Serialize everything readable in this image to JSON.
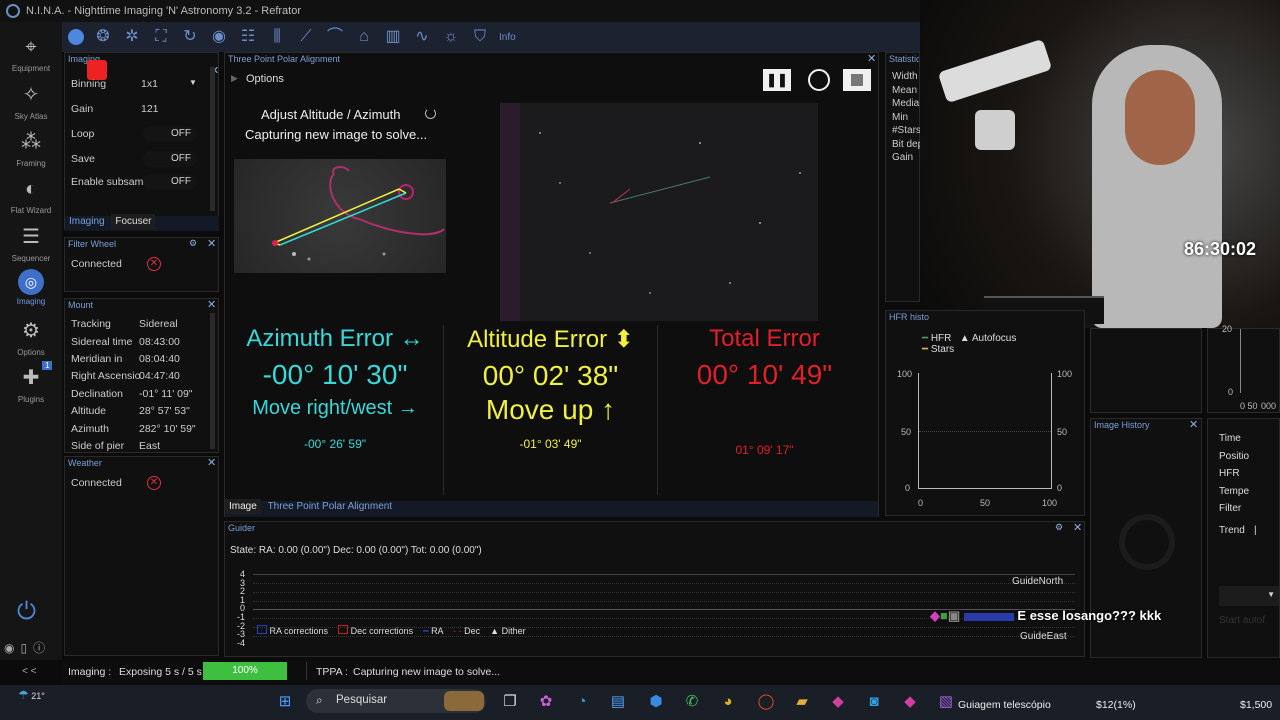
{
  "app": {
    "title": "N.I.N.A. - Nighttime Imaging 'N' Astronomy 3.2  -  Refrator"
  },
  "sidebar": {
    "items": [
      {
        "label": "Equipment"
      },
      {
        "label": "Sky Atlas"
      },
      {
        "label": "Framing"
      },
      {
        "label": "Flat Wizard"
      },
      {
        "label": "Sequencer"
      },
      {
        "label": "Imaging"
      },
      {
        "label": "Options"
      },
      {
        "label": "Plugins",
        "badge": "1"
      }
    ],
    "collapse": "< <"
  },
  "toolbar": {
    "info": "Info"
  },
  "imaging_panel": {
    "title": "Imaging",
    "rows": [
      {
        "label": "Binning",
        "value": "1x1"
      },
      {
        "label": "Gain",
        "value": "121"
      },
      {
        "label": "Loop",
        "value": "OFF"
      },
      {
        "label": "Save",
        "value": "OFF"
      },
      {
        "label": "Enable subsam",
        "value": "OFF"
      }
    ],
    "tabs": [
      "Imaging",
      "Focuser"
    ]
  },
  "filter_wheel": {
    "title": "Filter Wheel",
    "status": "Connected"
  },
  "mount": {
    "title": "Mount",
    "rows": [
      {
        "label": "Tracking",
        "value": "Sidereal"
      },
      {
        "label": "Sidereal time",
        "value": "08:43:00"
      },
      {
        "label": "Meridian in",
        "value": "08:04:40"
      },
      {
        "label": "Right Ascension",
        "value": "04:47:40"
      },
      {
        "label": "Declination",
        "value": "-01° 11' 09\""
      },
      {
        "label": "Altitude",
        "value": "28° 57' 53\""
      },
      {
        "label": "Azimuth",
        "value": "282° 10' 59\""
      },
      {
        "label": "Side of pier",
        "value": "East"
      }
    ]
  },
  "weather": {
    "title": "Weather",
    "status": "Connected"
  },
  "tppa": {
    "title": "Three Point Polar Alignment",
    "options": "Options",
    "step": "Adjust Altitude / Azimuth",
    "status": "Capturing new image to solve...",
    "azimuth": {
      "label": "Azimuth Error ↔",
      "value": "-00° 10' 30\"",
      "move": "Move right/west →",
      "detail": "-00° 26' 59\""
    },
    "altitude": {
      "label": "Altitude Error ⬍",
      "value": "00° 02' 38\"",
      "move": "Move up ↑",
      "detail": "-01° 03' 49\""
    },
    "total": {
      "label": "Total Error",
      "value": "00° 10' 49\"",
      "detail": "01° 09' 17\""
    },
    "tabs": [
      "Image",
      "Three Point Polar Alignment"
    ],
    "colors": {
      "az": "#36d8d8",
      "alt": "#f0f040",
      "total": "#e0202a"
    }
  },
  "statistics": {
    "title": "Statistics",
    "labels": [
      "Width",
      "Mean",
      "Media",
      "Min",
      "#Stars",
      "Bit dep",
      "Gain"
    ]
  },
  "hfr": {
    "title": "HFR histo",
    "legend": [
      "HFR",
      "Autofocus",
      "Stars"
    ],
    "y_left": [
      "100",
      "50",
      "0"
    ],
    "y_right": [
      "100",
      "50",
      "0"
    ],
    "x": [
      "0",
      "50",
      "100"
    ]
  },
  "image_history": {
    "title": "Image History"
  },
  "right_list": {
    "items": [
      "Time",
      "Positio",
      "HFR",
      "Tempe",
      "Filter",
      "Trend"
    ],
    "axis": [
      "20",
      "0",
      "0 50",
      "000"
    ],
    "button": "Start autof"
  },
  "guider": {
    "title": "Guider",
    "state": "State:  RA: 0.00 (0.00\")  Dec: 0.00 (0.00\")  Tot: 0.00 (0.00\")",
    "y": [
      "4",
      "3",
      "2",
      "1",
      "0",
      "-1",
      "-2",
      "-3",
      "-4"
    ],
    "north": "GuideNorth",
    "east": "GuideEast",
    "legend": [
      "RA corrections",
      "Dec corrections",
      "RA",
      "Dec",
      "Dither"
    ]
  },
  "statusbar": {
    "imaging_label": "Imaging :",
    "imaging_text": "Exposing 5 s / 5 s",
    "progress_text": "100%",
    "progress": 1.0,
    "tppa_label": "TPPA :",
    "tppa_text": "Capturing new image to solve..."
  },
  "overlay": {
    "timer": "86:30:02",
    "chat": "E esse losango??? kkk"
  },
  "taskbar": {
    "weather": "21°",
    "search": "Pesquisar",
    "item": "Guiagem telescópio",
    "amount": "$12(1%)",
    "amount2": "$1,500"
  }
}
